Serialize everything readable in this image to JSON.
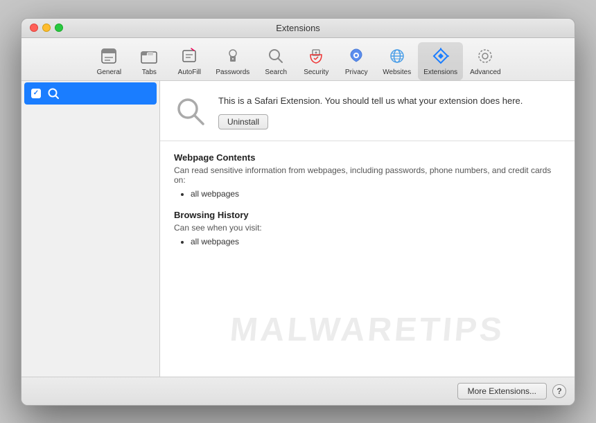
{
  "window": {
    "title": "Extensions"
  },
  "traffic_lights": {
    "close_label": "close",
    "minimize_label": "minimize",
    "maximize_label": "maximize"
  },
  "toolbar": {
    "items": [
      {
        "id": "general",
        "label": "General"
      },
      {
        "id": "tabs",
        "label": "Tabs"
      },
      {
        "id": "autofill",
        "label": "AutoFill"
      },
      {
        "id": "passwords",
        "label": "Passwords"
      },
      {
        "id": "search",
        "label": "Search"
      },
      {
        "id": "security",
        "label": "Security"
      },
      {
        "id": "privacy",
        "label": "Privacy"
      },
      {
        "id": "websites",
        "label": "Websites"
      },
      {
        "id": "extensions",
        "label": "Extensions"
      },
      {
        "id": "advanced",
        "label": "Advanced"
      }
    ],
    "active": "extensions"
  },
  "sidebar": {
    "items": [
      {
        "id": "search-ext",
        "label": "",
        "checked": true,
        "selected": true
      }
    ]
  },
  "extension_detail": {
    "description": "This is a Safari Extension. You should tell us what your extension does here.",
    "uninstall_label": "Uninstall",
    "permissions": [
      {
        "title": "Webpage Contents",
        "desc": "Can read sensitive information from webpages, including passwords, phone numbers, and credit cards on:",
        "items": [
          "all webpages"
        ]
      },
      {
        "title": "Browsing History",
        "desc": "Can see when you visit:",
        "items": [
          "all webpages"
        ]
      }
    ]
  },
  "footer": {
    "more_extensions_label": "More Extensions...",
    "help_label": "?"
  },
  "watermark": {
    "text": "MALWARETIPS"
  }
}
